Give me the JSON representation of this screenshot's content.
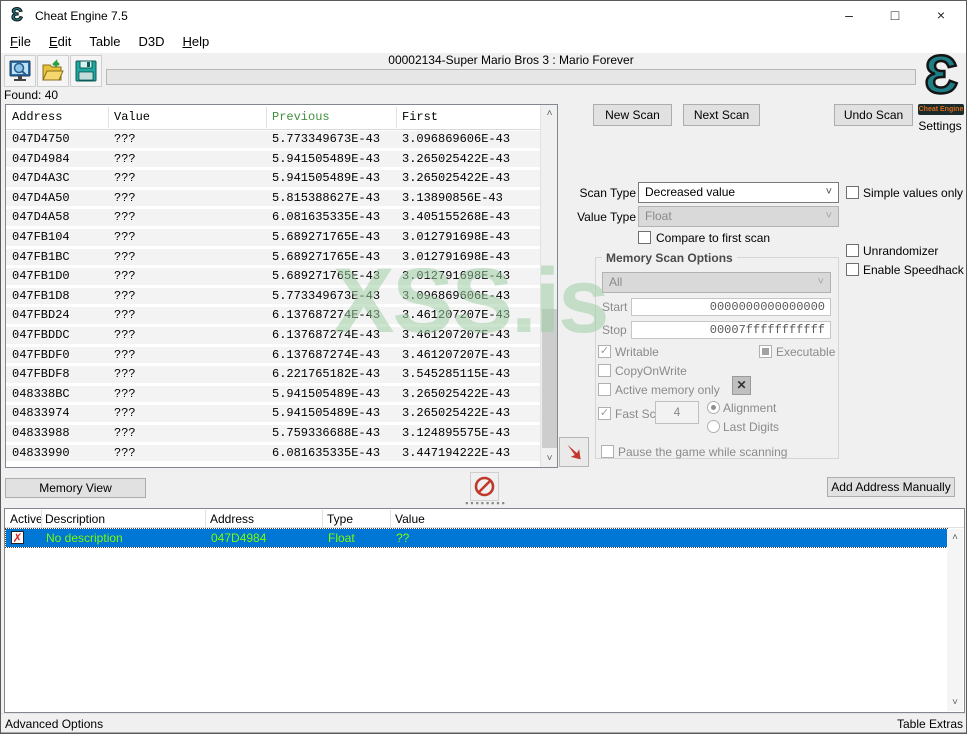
{
  "window": {
    "title": "Cheat Engine 7.5",
    "minimize": "–",
    "maximize": "□",
    "close": "×"
  },
  "menu": {
    "items": [
      {
        "label": "File",
        "underline_first": true
      },
      {
        "label": "Edit",
        "underline_first": true
      },
      {
        "label": "Table",
        "underline_first": false
      },
      {
        "label": "D3D",
        "underline_first": false
      },
      {
        "label": "Help",
        "underline_first": true
      }
    ]
  },
  "toolbar": {
    "process_label": "00002134-Super Mario Bros 3 : Mario Forever",
    "icons": [
      "select-process-icon",
      "open-file-icon",
      "save-file-icon"
    ],
    "progress_percent": 0
  },
  "found_list": {
    "found_label": "Found: 40",
    "columns": [
      "Address",
      "Value",
      "Previous",
      "First"
    ],
    "previous_header_color": "#3f8e3f",
    "rows": [
      [
        "047D4750",
        "???",
        "5.773349673E-43",
        "3.096869606E-43"
      ],
      [
        "047D4984",
        "???",
        "5.941505489E-43",
        "3.265025422E-43"
      ],
      [
        "047D4A3C",
        "???",
        "5.941505489E-43",
        "3.265025422E-43"
      ],
      [
        "047D4A50",
        "???",
        "5.815388627E-43",
        "3.13890856E-43"
      ],
      [
        "047D4A58",
        "???",
        "6.081635335E-43",
        "3.405155268E-43"
      ],
      [
        "047FB104",
        "???",
        "5.689271765E-43",
        "3.012791698E-43"
      ],
      [
        "047FB1BC",
        "???",
        "5.689271765E-43",
        "3.012791698E-43"
      ],
      [
        "047FB1D0",
        "???",
        "5.689271765E-43",
        "3.012791698E-43"
      ],
      [
        "047FB1D8",
        "???",
        "5.773349673E-43",
        "3.096869606E-43"
      ],
      [
        "047FBD24",
        "???",
        "6.137687274E-43",
        "3.461207207E-43"
      ],
      [
        "047FBDDC",
        "???",
        "6.137687274E-43",
        "3.461207207E-43"
      ],
      [
        "047FBDF0",
        "???",
        "6.137687274E-43",
        "3.461207207E-43"
      ],
      [
        "047FBDF8",
        "???",
        "6.221765182E-43",
        "3.545285115E-43"
      ],
      [
        "048338BC",
        "???",
        "5.941505489E-43",
        "3.265025422E-43"
      ],
      [
        "04833974",
        "???",
        "5.941505489E-43",
        "3.265025422E-43"
      ],
      [
        "04833988",
        "???",
        "5.759336688E-43",
        "3.124895575E-43"
      ],
      [
        "04833990",
        "???",
        "6.081635335E-43",
        "3.447194222E-43"
      ]
    ]
  },
  "scan_panel": {
    "new_scan": "New Scan",
    "next_scan": "Next Scan",
    "undo_scan": "Undo Scan",
    "settings": "Settings",
    "logo_glyph": "Ɛ",
    "logo_banner": "Cheat Engine",
    "scan_type_label": "Scan Type",
    "scan_type_value": "Decreased value",
    "value_type_label": "Value Type",
    "value_type_value": "Float",
    "compare_to_first_scan": "Compare to first scan",
    "simple_values_only": "Simple values only",
    "unrandomizer": "Unrandomizer",
    "enable_speedhack": "Enable Speedhack"
  },
  "memory_scan_options": {
    "title": "Memory Scan Options",
    "region_value": "All",
    "start_label": "Start",
    "start_value": "0000000000000000",
    "stop_label": "Stop",
    "stop_value": "00007fffffffffff",
    "writable": "Writable",
    "executable": "Executable",
    "copy_on_write": "CopyOnWrite",
    "active_memory_only": "Active memory only",
    "fast_scan": "Fast Scan",
    "fast_scan_value": "4",
    "alignment": "Alignment",
    "last_digits": "Last Digits",
    "pause_while_scanning": "Pause the game while scanning"
  },
  "bottom_controls": {
    "memory_view": "Memory View",
    "add_address_manually": "Add Address Manually"
  },
  "address_table": {
    "columns": [
      "Active",
      "Description",
      "Address",
      "Type",
      "Value"
    ],
    "rows": [
      {
        "active": false,
        "description": "No description",
        "address": "047D4984",
        "type": "Float",
        "value": "??"
      }
    ],
    "selected_row_color": "#0077d4",
    "row_text_color": "#7cfc00"
  },
  "statusbar": {
    "left": "Advanced Options",
    "right": "Table Extras"
  },
  "watermark": "XSS.is",
  "colors": {
    "accent_blue": "#0077d4",
    "logo_teal": "#1d7e86",
    "warning_red": "#c0392b",
    "window_bg": "#f0f0f0"
  }
}
